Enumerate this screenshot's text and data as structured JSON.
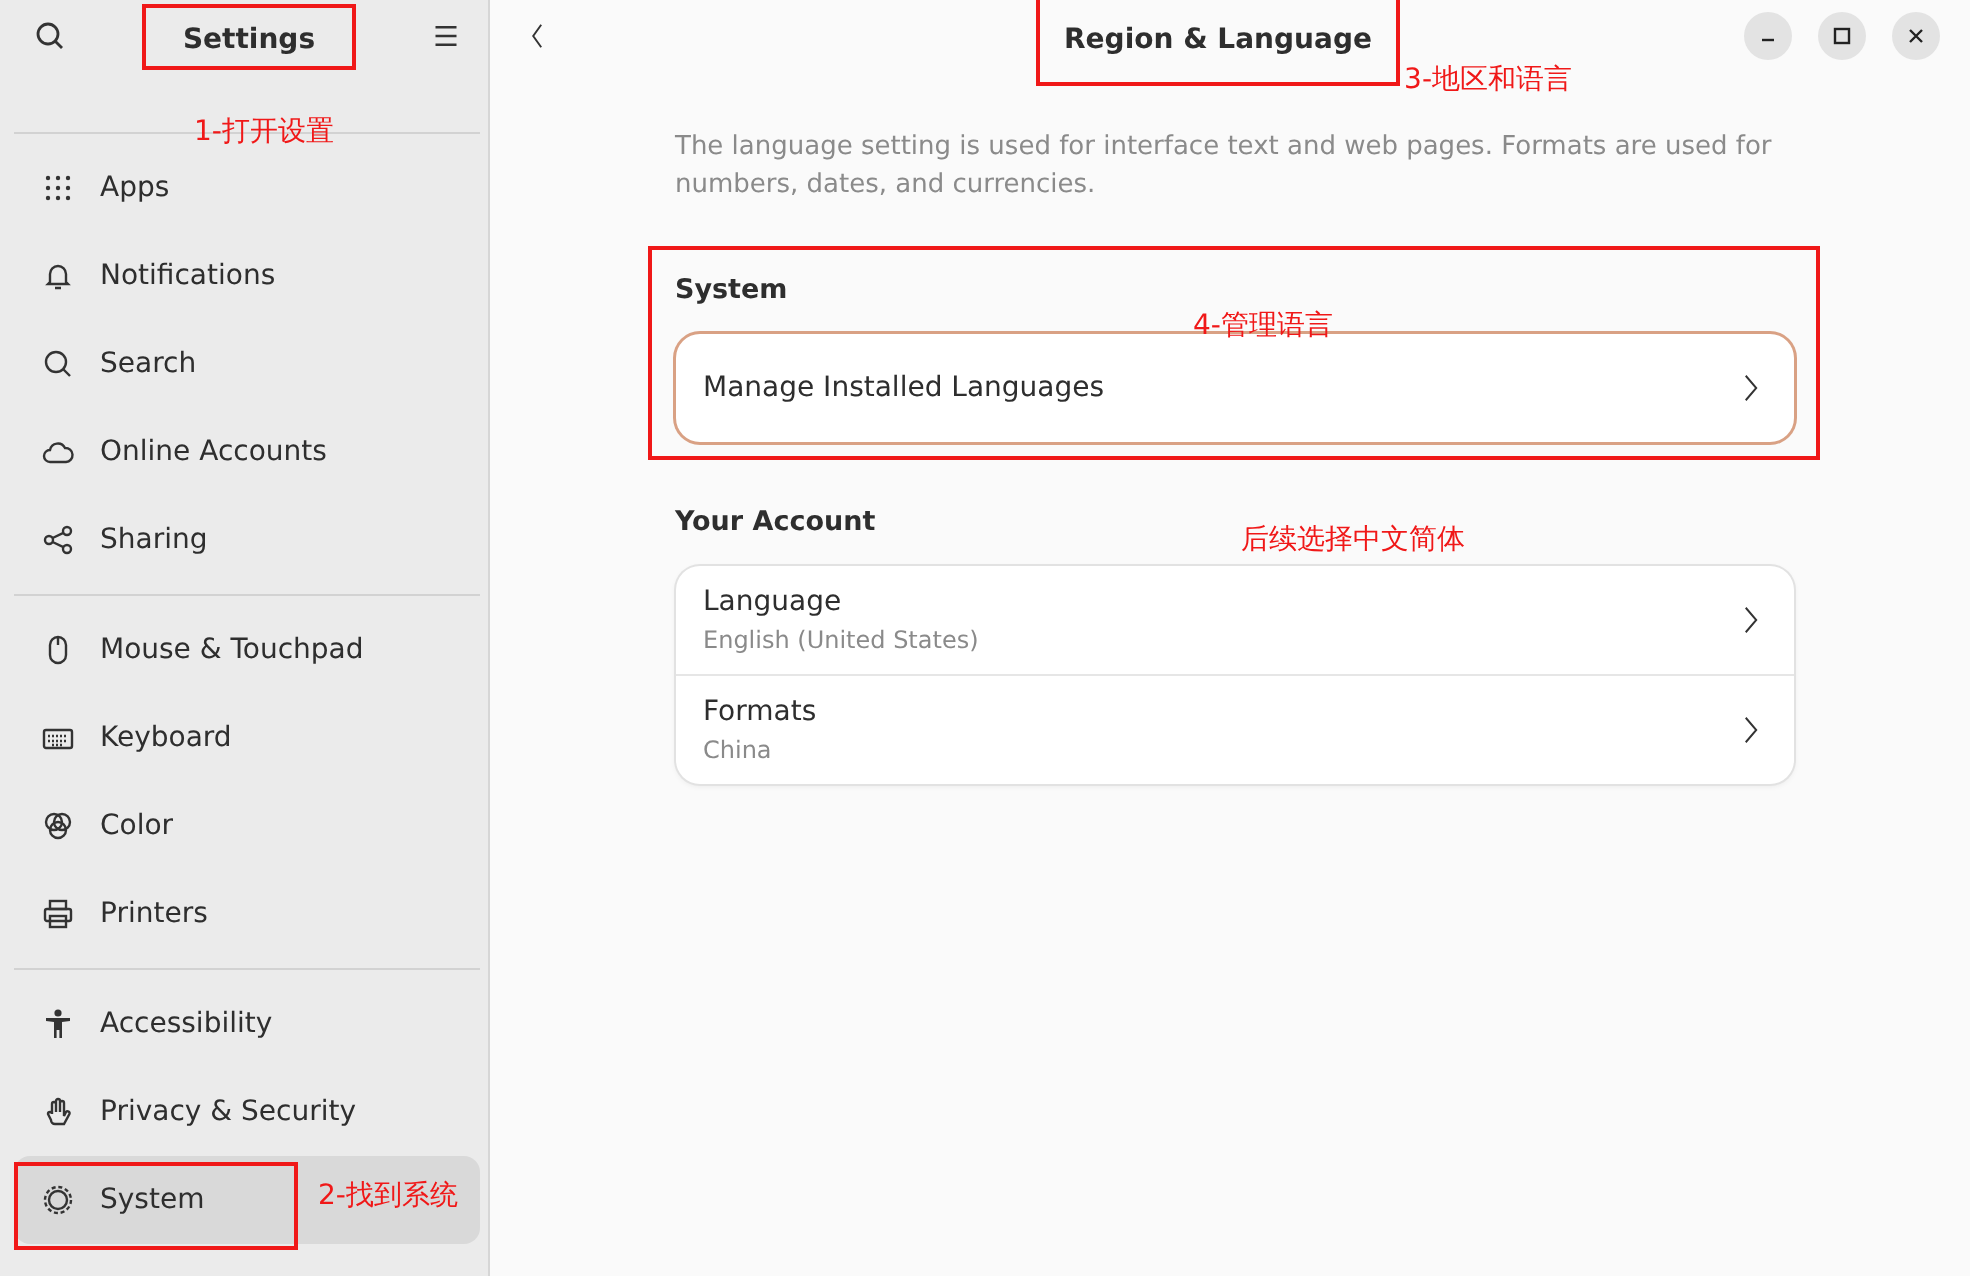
{
  "sidebar": {
    "title": "Settings",
    "boxed": true,
    "note": "1-打开设置",
    "groups": [
      [
        {
          "label": "Apps",
          "kind": "apps",
          "selected": false,
          "boxed": false
        },
        {
          "label": "Notifications",
          "kind": "bell",
          "selected": false,
          "boxed": false
        },
        {
          "label": "Search",
          "kind": "search",
          "selected": false,
          "boxed": false
        },
        {
          "label": "Online Accounts",
          "kind": "cloud",
          "selected": false,
          "boxed": false
        },
        {
          "label": "Sharing",
          "kind": "share",
          "selected": false,
          "boxed": false
        }
      ],
      [
        {
          "label": "Mouse & Touchpad",
          "kind": "mouse",
          "selected": false,
          "boxed": false
        },
        {
          "label": "Keyboard",
          "kind": "keyboard",
          "selected": false,
          "boxed": false
        },
        {
          "label": "Color",
          "kind": "color",
          "selected": false,
          "boxed": false
        },
        {
          "label": "Printers",
          "kind": "printer",
          "selected": false,
          "boxed": false
        }
      ],
      [
        {
          "label": "Accessibility",
          "kind": "person",
          "selected": false,
          "boxed": false
        },
        {
          "label": "Privacy & Security",
          "kind": "hand",
          "selected": false,
          "boxed": false
        },
        {
          "label": "System",
          "kind": "gear",
          "selected": true,
          "boxed": true,
          "note": "2-找到系统"
        }
      ]
    ]
  },
  "page": {
    "title": "Region & Language",
    "boxed": true,
    "note": "3-地区和语言",
    "description": "The language setting is used for interface text and web pages. Formats are used for numbers, dates, and currencies.",
    "sections": [
      {
        "heading": "System",
        "boxed": true,
        "focused": true,
        "note": "4-管理语言",
        "rows": [
          {
            "title": "Manage Installed Languages"
          }
        ]
      },
      {
        "heading": "Your Account",
        "boxed": false,
        "focused": false,
        "note": "后续选择中文简体",
        "rows": [
          {
            "title": "Language",
            "subtitle": "English (United States)"
          },
          {
            "title": "Formats",
            "subtitle": "China"
          }
        ]
      }
    ]
  }
}
